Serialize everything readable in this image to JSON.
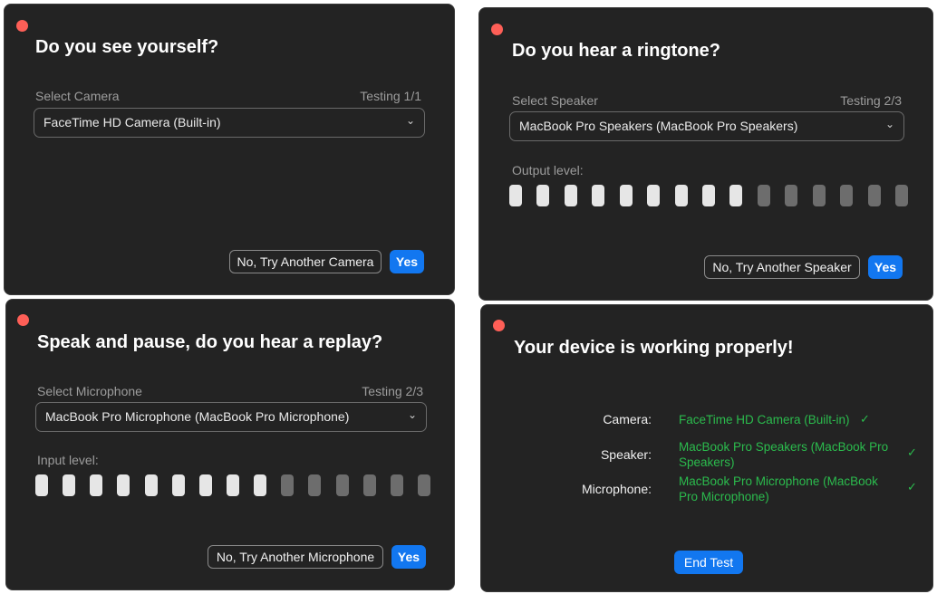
{
  "colors": {
    "panel_bg": "#232323",
    "accent": "#1277f0",
    "success": "#2bbb4d",
    "bar_on": "#e6e6e6",
    "bar_off": "#6d6d6d",
    "dot": "#fe5f57"
  },
  "camera_panel": {
    "title": "Do you see yourself?",
    "select_label": "Select Camera",
    "testing": "Testing 1/1",
    "selected": "FaceTime HD Camera (Built-in)",
    "chevron": "⌄",
    "no_button": "No, Try Another Camera",
    "yes_button": "Yes"
  },
  "speaker_panel": {
    "title": "Do you hear a ringtone?",
    "select_label": "Select Speaker",
    "testing": "Testing 2/3",
    "selected": "MacBook Pro Speakers (MacBook Pro Speakers)",
    "chevron": "⌄",
    "level_label": "Output level:",
    "level": {
      "total": 15,
      "active": 9
    },
    "no_button": "No, Try Another Speaker",
    "yes_button": "Yes"
  },
  "microphone_panel": {
    "title": "Speak and pause, do you hear a replay?",
    "select_label": "Select Microphone",
    "testing": "Testing 2/3",
    "selected": "MacBook Pro Microphone (MacBook Pro Microphone)",
    "chevron": "⌄",
    "level_label": "Input level:",
    "level": {
      "total": 15,
      "active": 9
    },
    "no_button": "No, Try Another Microphone",
    "yes_button": "Yes"
  },
  "summary_panel": {
    "title": "Your device is working properly!",
    "rows": [
      {
        "label": "Camera:",
        "value": "FaceTime HD Camera (Built-in)",
        "check": "✓"
      },
      {
        "label": "Speaker:",
        "value": "MacBook Pro Speakers (MacBook Pro Speakers)",
        "check": "✓"
      },
      {
        "label": "Microphone:",
        "value": "MacBook Pro Microphone (MacBook Pro Microphone)",
        "check": "✓"
      }
    ],
    "end_button": "End Test"
  }
}
